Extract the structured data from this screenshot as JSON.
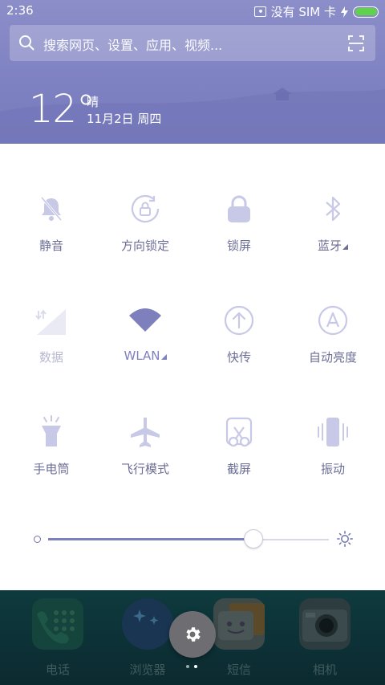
{
  "status_bar": {
    "time": "2:36",
    "sim_text": "没有 SIM 卡",
    "battery_color": "#5fd14b"
  },
  "search": {
    "placeholder": "搜索网页、设置、应用、视频..."
  },
  "weather": {
    "temperature": "12°",
    "condition": "晴",
    "date": "11月2日 周四"
  },
  "toggles": [
    {
      "label": "静音",
      "icon": "mute-bell-icon",
      "state": "on"
    },
    {
      "label": "方向锁定",
      "icon": "rotation-lock-icon",
      "state": "on"
    },
    {
      "label": "锁屏",
      "icon": "lock-icon",
      "state": "on"
    },
    {
      "label": "蓝牙",
      "icon": "bluetooth-icon",
      "state": "on",
      "expandable": true
    },
    {
      "label": "数据",
      "icon": "mobile-data-icon",
      "state": "off"
    },
    {
      "label": "WLAN",
      "icon": "wifi-icon",
      "state": "active",
      "expandable": true
    },
    {
      "label": "快传",
      "icon": "transfer-icon",
      "state": "on"
    },
    {
      "label": "自动亮度",
      "icon": "auto-brightness-icon",
      "state": "on"
    },
    {
      "label": "手电筒",
      "icon": "flashlight-icon",
      "state": "on"
    },
    {
      "label": "飞行模式",
      "icon": "airplane-icon",
      "state": "on"
    },
    {
      "label": "截屏",
      "icon": "screenshot-scissors-icon",
      "state": "on"
    },
    {
      "label": "振动",
      "icon": "vibrate-icon",
      "state": "on"
    }
  ],
  "brightness": {
    "level_percent": 73
  },
  "dock": {
    "apps": [
      {
        "label": "电话",
        "icon": "phone-icon"
      },
      {
        "label": "浏览器",
        "icon": "browser-icon"
      },
      {
        "label": "短信",
        "icon": "messages-icon"
      },
      {
        "label": "相机",
        "icon": "camera-icon"
      }
    ]
  },
  "colors": {
    "header": "#7f82c2",
    "accent": "#7d80bd",
    "label": "#6b6e96",
    "label_disabled": "#b7b9d2"
  }
}
